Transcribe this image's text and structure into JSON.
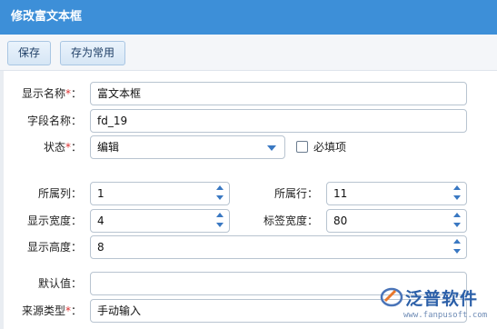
{
  "window": {
    "title": "修改富文本框"
  },
  "toolbar": {
    "save_label": "保存",
    "save_common_label": "存为常用"
  },
  "form": {
    "display_name": {
      "label": "显示名称",
      "required_mark": "*",
      "suffix": "：",
      "value": "富文本框"
    },
    "field_name": {
      "label": "字段名称：",
      "value": "fd_19"
    },
    "state": {
      "label": "状态",
      "required_mark": "*",
      "suffix": "：",
      "value": "编辑"
    },
    "required_checkbox": {
      "label": "必填项",
      "checked": false
    },
    "column": {
      "label": "所属列：",
      "value": "1"
    },
    "row": {
      "label": "所属行：",
      "value": "11"
    },
    "display_width": {
      "label": "显示宽度：",
      "value": "4"
    },
    "label_width": {
      "label": "标签宽度：",
      "value": "80"
    },
    "display_height": {
      "label": "显示高度：",
      "value": "8"
    },
    "default_value": {
      "label": "默认值：",
      "value": ""
    },
    "source_type": {
      "label": "来源类型",
      "required_mark": "*",
      "suffix": "：",
      "value": "手动输入"
    }
  },
  "watermark": {
    "brand": "泛普软件",
    "url": "www.fanpusoft.com"
  },
  "colors": {
    "titlebar": "#3d8fd8",
    "accent": "#3a78c2",
    "required": "#d33"
  }
}
